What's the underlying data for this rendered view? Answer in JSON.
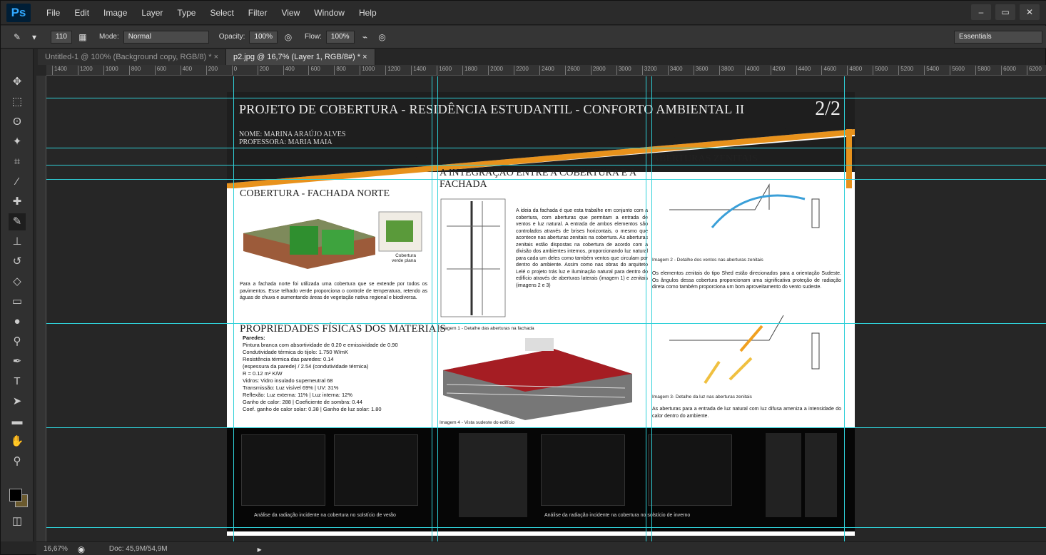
{
  "app": {
    "logo": "Ps"
  },
  "menu": [
    "File",
    "Edit",
    "Image",
    "Layer",
    "Type",
    "Select",
    "Filter",
    "View",
    "Window",
    "Help"
  ],
  "window_controls": [
    "–",
    "▭",
    "✕"
  ],
  "options": {
    "brush_size": "110",
    "mode_label": "Mode:",
    "mode_value": "Normal",
    "opacity_label": "Opacity:",
    "opacity_value": "100%",
    "flow_label": "Flow:",
    "flow_value": "100%",
    "workspace": "Essentials"
  },
  "tabs": [
    {
      "label": "Untitled-1 @ 100% (Background copy, RGB/8) *  ×"
    },
    {
      "label": "p2.jpg @ 16,7% (Layer 1, RGB/8#) *  ×"
    }
  ],
  "ruler_labels": [
    "1400",
    "1200",
    "1000",
    "800",
    "600",
    "400",
    "200",
    "0",
    "200",
    "400",
    "600",
    "800",
    "1000",
    "1200",
    "1400",
    "1600",
    "1800",
    "2000",
    "2200",
    "2400",
    "2600",
    "2800",
    "3000",
    "3200",
    "3400",
    "3600",
    "3800",
    "4000",
    "4200",
    "4400",
    "4600",
    "4800",
    "5000",
    "5200",
    "5400",
    "5600",
    "5800",
    "6000",
    "6200"
  ],
  "doc": {
    "title": "PROJETO DE COBERTURA - RESIDÊNCIA ESTUDANTIL - CONFORTO AMBIENTAL II",
    "page": "2/2",
    "name": "NOME: MARINA ARAÚJO ALVES",
    "teacher": "PROFESSORA: MARIA MAIA",
    "sec1_title": "COBERTURA - FACHADA NORTE",
    "sec1_img_label": "Cobertura verde plana",
    "sec1_text": "Para a fachada norte foi utilizada uma cobertura que se extende por todos os pavimentos. Esse telhado verde proporciona o controle de temperatura, retendo as águas de chuva e aumentando áreas de vegetação nativa regional e biodiversa.",
    "sec2_title": "A INTEGRAÇÃO ENTRE A COBERTURA E A FACHADA",
    "sec2_text": "A ideia da fachada é que esta trabalhe em conjunto com a cobertura, com aberturas que permitam a entrada de ventos e luz natural. A entrada de ambos elementos são controlados através de brises horizontais, o mesmo que acontece nas aberturas zenitais na cobertura. As aberturas zenitais estão dispostas na cobertura de acordo com a divisão dos ambientes internos, proporcionando luz natural para cada um deles como também ventos que circulam por dentro do ambiente. Assim como nas obras do arquiteto Lelé o projeto trás luz e iluminação natural para dentro do edifício através de aberturas laterais (imagem 1) e zenitais (imagens 2 e 3)",
    "img1_caption": "Imagem 1 - Detalhe das aberturas na fachada",
    "img4_caption": "Imagem 4 - Vista sudeste do edifício",
    "sec3_title": "ABERTURAS ZENITAIS",
    "img2_caption": "Imagem 2 - Detalhe dos ventos nas aberturas zenitais",
    "sec3_text1": "Os elementos zenitais do tipo Shed estão direcionados para a orientação Sudeste. Os ângulos dessa cobertura proporcionam uma significativa proteção de radiação direta como também proporciona um bom aproveitamento do vento sudeste.",
    "img3_caption": "Imagem 3- Detalhe da luz nas aberturas zenitais",
    "sec3_text2": "As aberturas para a entrada de luz natural com luz difusa ameniza a intensidade do calor dentro do ambiente.",
    "props_title": "PROPRIEDADES FÍSICAS DOS MATERIAIS",
    "props": {
      "l1": "Paredes:",
      "l2": "Pintura branca com absortividade de 0.20 e emissividade de 0.90",
      "l3": "Condutividade térmica do tijolo: 1.750 W/mK",
      "l4": "Resistência térmica das paredes: 0.14",
      "l5": "(espessura da parede)  /  2.54 (condutividade térmica)",
      "l6": "R = 0.12 m² K/W",
      "l7": "Vidros: Vidro insulado supemeutral 68",
      "l8": "Transmissão: Luz visível 69%  |  UV: 31%",
      "l9": "Reflexão: Luz externa: 11%  |  Luz interna: 12%",
      "l10": "Ganho de calor: 288  |  Coeficiente de sombra: 0.44",
      "l11": "Coef. ganho de calor solar: 0.38  |  Ganho de luz solar: 1.80"
    },
    "bottom_caption_left": "Análise da radiação incidente na cobertura no solstício de verão",
    "bottom_caption_right": "Análise da radiação incidente na cobertura no solstício de inverno"
  },
  "status": {
    "zoom": "16,67%",
    "doc": "Doc: 45,9M/54,9M"
  }
}
